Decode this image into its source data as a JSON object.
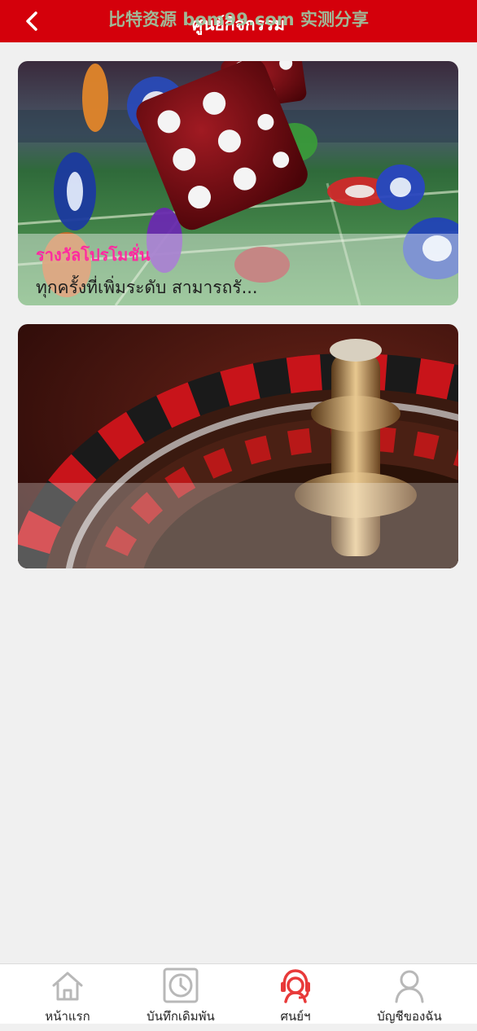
{
  "header": {
    "title": "ศูนย์กิจกรรม",
    "watermark": "比特资源 bom99.com 实测分享",
    "background": "#d4000b"
  },
  "cards": [
    {
      "title": "รางวัลโปรโมชั่น",
      "description": "ทุกครั้งที่เพิ่มระดับ สามารถรั...",
      "image": "dice-and-casino-chips"
    },
    {
      "title": "",
      "description": "",
      "image": "roulette-wheel"
    }
  ],
  "bottom_nav": {
    "items": [
      {
        "label": "หน้าแรก",
        "icon": "home-icon",
        "active": false
      },
      {
        "label": "บันทึกเดิมพัน",
        "icon": "clock-icon",
        "active": false
      },
      {
        "label": "ศนย์ฯ",
        "icon": "support-icon",
        "active": true
      },
      {
        "label": "บัญชีของฉัน",
        "icon": "user-icon",
        "active": false
      }
    ],
    "active_color": "#e83a3a",
    "inactive_color": "#b8b8b8"
  }
}
